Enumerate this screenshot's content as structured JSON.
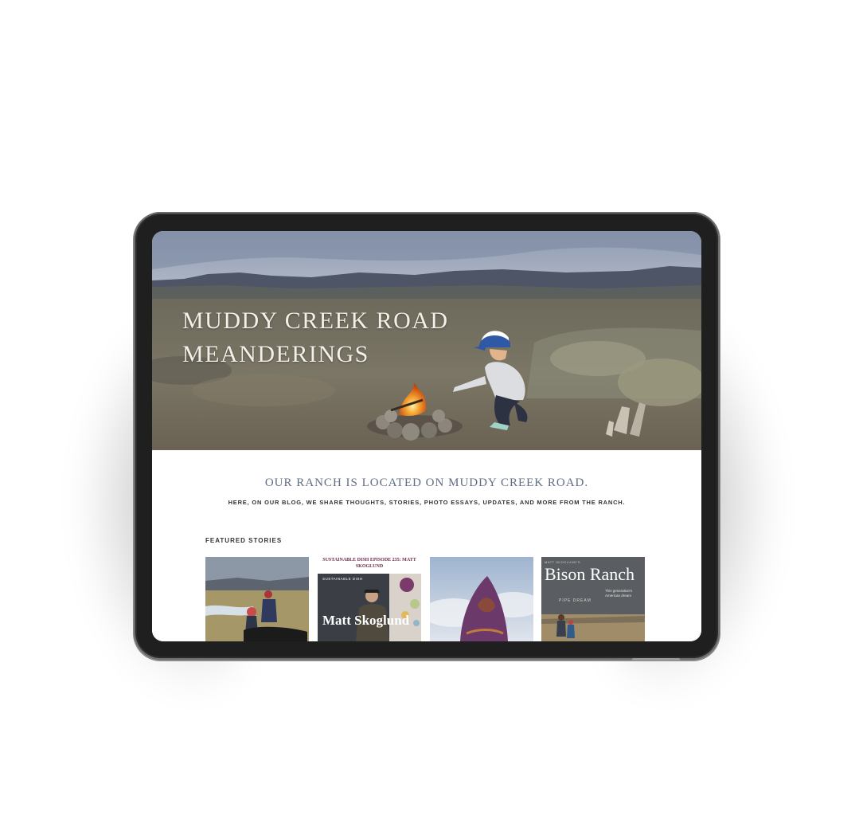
{
  "site": {
    "hero_title_line1": "MUDDY CREEK ROAD",
    "hero_title_line2": "MEANDERINGS",
    "tagline": "OUR RANCH IS LOCATED ON MUDDY CREEK ROAD.",
    "subline": "HERE, ON OUR BLOG, WE SHARE THOUGHTS, STORIES, PHOTO ESSAYS, UPDATES, AND MORE FROM THE RANCH."
  },
  "featured": {
    "label": "FEATURED STORIES",
    "cards": [
      {
        "kind": "photo",
        "subject": "children-with-dog-in-field"
      },
      {
        "kind": "podcast",
        "title": "SUSTAINABLE DISH EPISODE 235: MATT SKOGLUND",
        "art_name": "Matt Skoglund"
      },
      {
        "kind": "photo",
        "subject": "painted-rock-sky"
      },
      {
        "kind": "article",
        "title": "Bison Ranch",
        "subtitle": "PIPE DREAM"
      }
    ]
  },
  "colors": {
    "tagline": "#5f6e84",
    "podcast_title": "#6b2a4a",
    "bezel": "#1f1f1f"
  }
}
